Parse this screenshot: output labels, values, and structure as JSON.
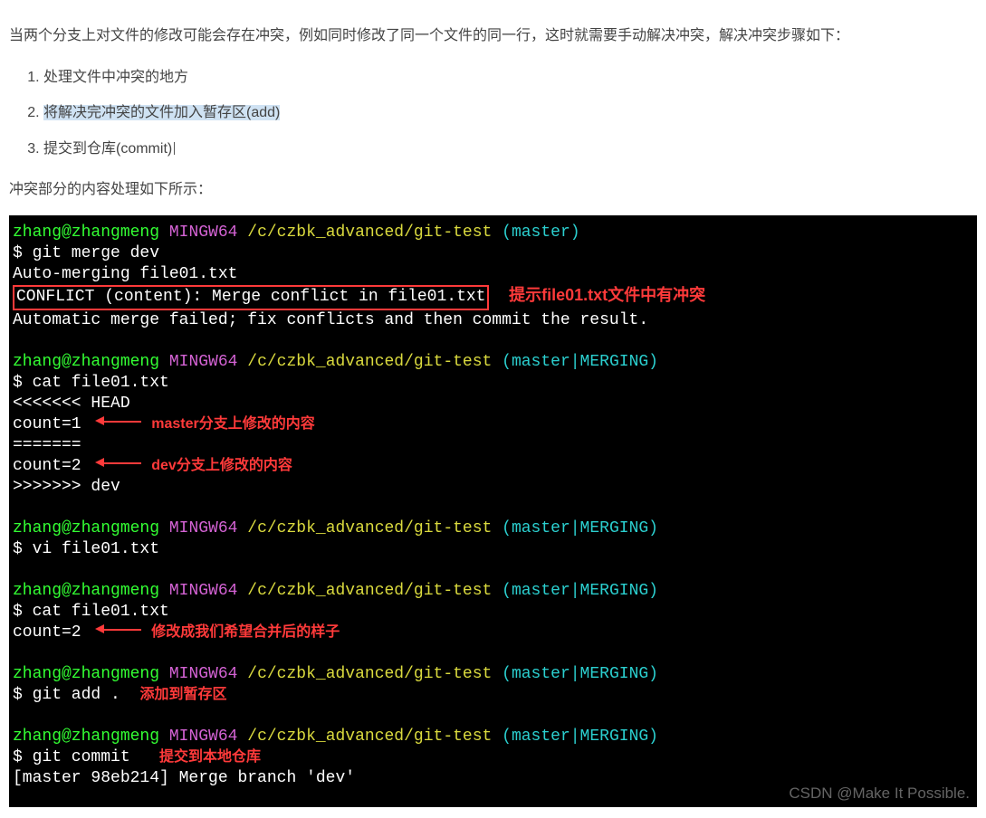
{
  "intro": "当两个分支上对文件的修改可能会存在冲突，例如同时修改了同一个文件的同一行，这时就需要手动解决冲突，解决冲突步骤如下：",
  "steps": {
    "s1": "处理文件中冲突的地方",
    "s2": "将解决完冲突的文件加入暂存区(add)",
    "s3": "提交到仓库(commit)"
  },
  "subintro": "冲突部分的内容处理如下所示：",
  "prompt": {
    "user": "zhang@zhangmeng",
    "host": "MINGW64",
    "path": "/c/czbk_advanced/git-test",
    "branch_master": "(master)",
    "branch_merging": "(master|MERGING)"
  },
  "cmd": {
    "merge": "$ git merge dev",
    "automerging": "Auto-merging file01.txt",
    "conflict": "CONFLICT (content): Merge conflict in file01.txt",
    "failed": "Automatic merge failed; fix conflicts and then commit the result.",
    "cat1": "$ cat file01.txt",
    "head": "<<<<<<< HEAD",
    "c1": "count=1",
    "sep": "=======",
    "c2": "count=2",
    "devmark": ">>>>>>> dev",
    "vi": "$ vi file01.txt",
    "cat2": "$ cat file01.txt",
    "c2b": "count=2",
    "add": "$ git add .",
    "commit": "$ git commit",
    "result": "[master 98eb214] Merge branch 'dev'"
  },
  "notes": {
    "conflict_hint": "提示file01.txt文件中有冲突",
    "master_note": "master分支上修改的内容",
    "dev_note": "dev分支上修改的内容",
    "after_note": "修改成我们希望合并后的样子",
    "add_note": "添加到暂存区",
    "commit_note": "提交到本地仓库"
  },
  "watermark": "CSDN @Make It Possible."
}
